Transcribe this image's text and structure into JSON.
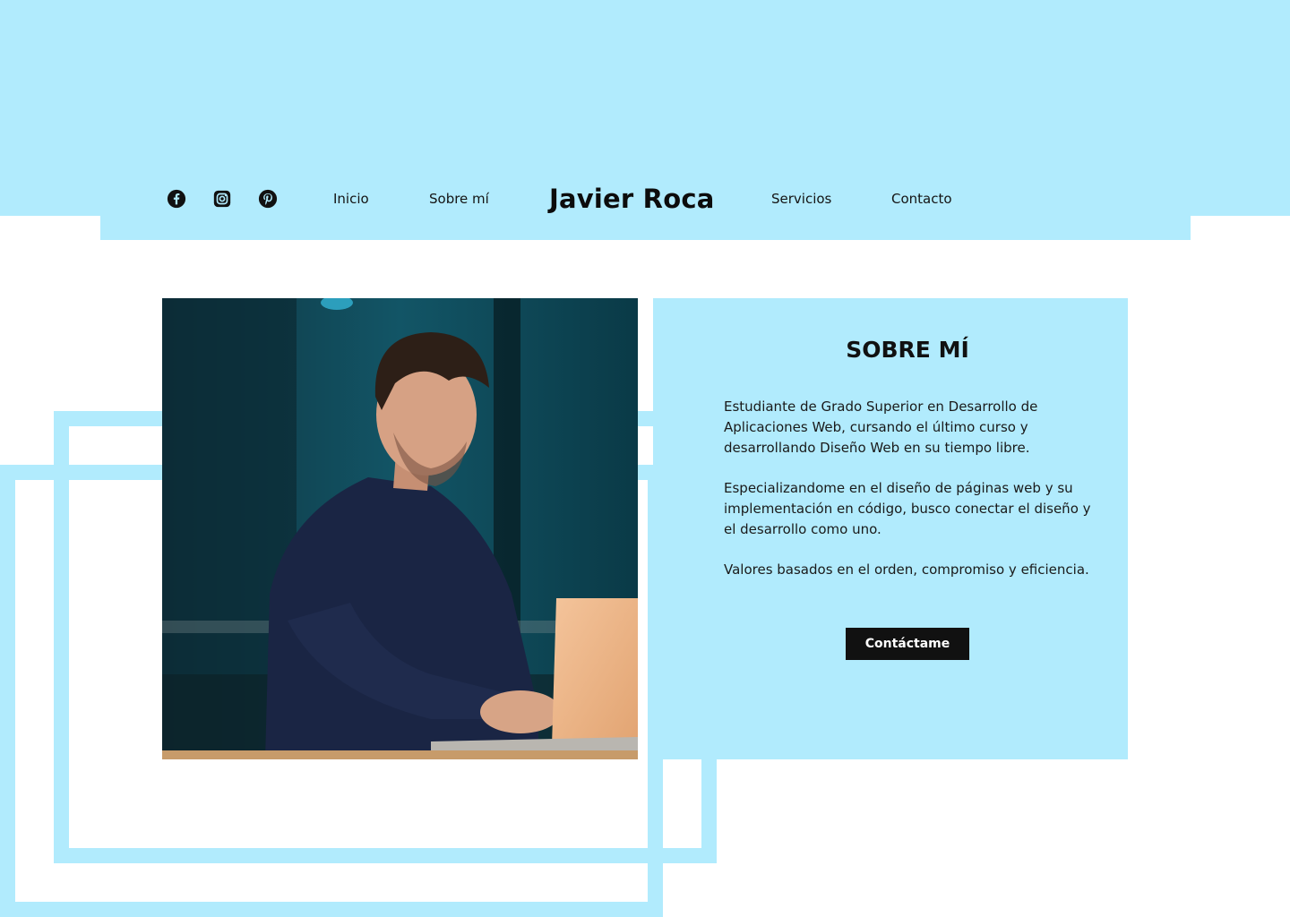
{
  "colors": {
    "accent": "#b1ebfd",
    "button_bg": "#111111",
    "text": "#141414"
  },
  "header": {
    "social": [
      {
        "icon": "facebook-icon"
      },
      {
        "icon": "instagram-icon"
      },
      {
        "icon": "pinterest-icon"
      }
    ],
    "nav_left": [
      "Inicio",
      "Sobre mí"
    ],
    "brand": "Javier Roca",
    "nav_right": [
      "Servicios",
      "Contacto"
    ]
  },
  "about": {
    "title": "SOBRE MÍ",
    "paragraphs": [
      "Estudiante de Grado Superior en Desarrollo de Aplicaciones Web, cursando el último curso y desarrollando Diseño Web en su tiempo libre.",
      "Especializandome en el diseño de páginas web y su implementación en código, busco conectar el diseño y el desarrollo como uno.",
      "Valores basados en el orden, compromiso y eficiencia."
    ],
    "cta_label": "Contáctame"
  }
}
